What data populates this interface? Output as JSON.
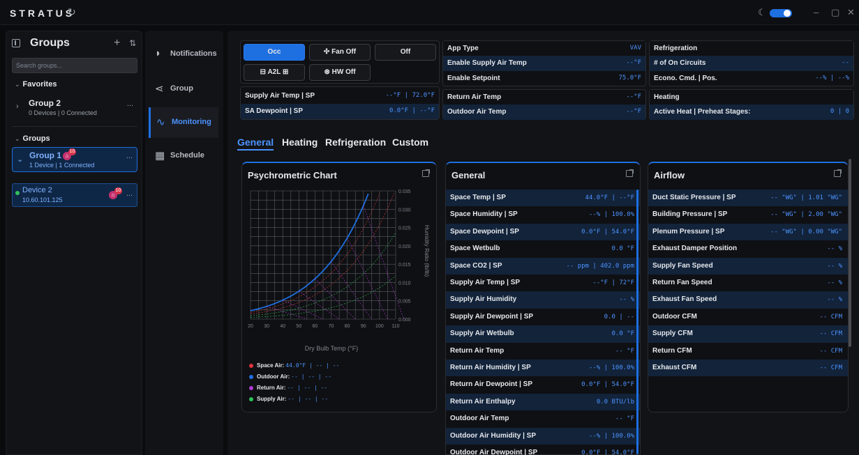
{
  "app": {
    "title": "STRATUS",
    "refresh_icon": "refresh-icon",
    "theme_icon": "moon-icon",
    "win_min": "–",
    "win_max": "▢",
    "win_close": "✕"
  },
  "groups": {
    "title": "Groups",
    "add_icon": "+",
    "sort_icon": "⇅",
    "search_placeholder": "Search groups...",
    "favorites_label": "Favorites",
    "groups_label": "Groups",
    "favorites": [
      {
        "name": "Group 2",
        "sub": "0 Devices | 0 Connected",
        "menu": "..."
      }
    ],
    "list": [
      {
        "name": "Group 1",
        "sub": "1 Device | 1 Connected",
        "badge": "10",
        "menu": "..."
      }
    ],
    "device": {
      "name": "Device 2",
      "ip": "10.60.101.125",
      "badge": "10",
      "menu": "..."
    }
  },
  "nav": [
    {
      "label": "Notifications",
      "icon": "notifications-icon"
    },
    {
      "label": "Group",
      "icon": "share-icon"
    },
    {
      "label": "Monitoring",
      "icon": "chart-icon"
    },
    {
      "label": "Schedule",
      "icon": "calendar-icon"
    }
  ],
  "controls": {
    "occ": "Occ",
    "fan": "Fan Off",
    "off": "Off",
    "a2l": "A2L",
    "hw": "HW Off"
  },
  "supply": [
    {
      "k": "Supply Air Temp | SP",
      "v": "--°F | 72.0°F"
    },
    {
      "k": "SA Dewpoint | SP",
      "v": "0.0°F | --°F"
    }
  ],
  "app_info": [
    {
      "k": "App Type",
      "v": "VAV"
    },
    {
      "k": "Enable Supply Air Temp",
      "v": "--°F"
    },
    {
      "k": "Enable Setpoint",
      "v": "75.0°F"
    }
  ],
  "return_info": [
    {
      "k": "Return Air Temp",
      "v": "--°F"
    },
    {
      "k": "Outdoor Air Temp",
      "v": "--°F"
    }
  ],
  "refrigeration": [
    {
      "k": "Refrigeration",
      "v": ""
    },
    {
      "k": "# of On Circuits",
      "v": "--"
    },
    {
      "k": "Econo. Cmd. | Pos.",
      "v": "--% | --%"
    }
  ],
  "heating": [
    {
      "k": "Heating",
      "v": ""
    },
    {
      "k": "Active Heat | Preheat Stages:",
      "v": "0 | 0"
    }
  ],
  "tabs": [
    "General",
    "Heating",
    "Refrigeration",
    "Custom"
  ],
  "psychro": {
    "title": "Psychrometric Chart",
    "xlabel": "Dry Bulb Temp (°F)",
    "ylabel": "Humidity Ratio (lb/lb)",
    "x_ticks": [
      "20",
      "30",
      "40",
      "50",
      "60",
      "70",
      "80",
      "90",
      "100",
      "110"
    ],
    "y_ticks": [
      "0.035",
      "0.030",
      "0.025",
      "0.020",
      "0.015",
      "0.010",
      "0.005",
      "0.000"
    ],
    "legend": [
      {
        "label": "Space Air:",
        "value": "44.0°F | -- | --",
        "color": "#e0323c"
      },
      {
        "label": "Outdoor Air:",
        "value": "-- | -- | --",
        "color": "#1e6fe0"
      },
      {
        "label": "Return Air:",
        "value": "-- | -- | --",
        "color": "#b23ad6"
      },
      {
        "label": "Supply Air:",
        "value": "-- | -- | --",
        "color": "#2fc25b"
      }
    ]
  },
  "general": {
    "title": "General",
    "rows": [
      {
        "k": "Space Temp | SP",
        "v": "44.0°F | --°F"
      },
      {
        "k": "Space Humidity | SP",
        "v": "--% | 100.0%"
      },
      {
        "k": "Space Dewpoint | SP",
        "v": "0.0°F | 54.0°F"
      },
      {
        "k": "Space Wetbulb",
        "v": "0.0 °F"
      },
      {
        "k": "Space CO2 | SP",
        "v": "-- ppm | 402.0 ppm"
      },
      {
        "k": "Supply Air Temp | SP",
        "v": "--°F | 72°F"
      },
      {
        "k": "Supply Air Humidity",
        "v": "-- %"
      },
      {
        "k": "Supply Air Dewpoint | SP",
        "v": "0.0 | --"
      },
      {
        "k": "Supply Air Wetbulb",
        "v": "0.0 °F"
      },
      {
        "k": "Return Air Temp",
        "v": "-- °F"
      },
      {
        "k": "Return Air Humidity | SP",
        "v": "--% | 100.0%"
      },
      {
        "k": "Return Air Dewpoint | SP",
        "v": "0.0°F | 54.0°F"
      },
      {
        "k": "Return Air Enthalpy",
        "v": "0.0 BTU/lb"
      },
      {
        "k": "Outdoor Air Temp",
        "v": "-- °F"
      },
      {
        "k": "Outdoor Air Humidity | SP",
        "v": "--% | 100.0%"
      },
      {
        "k": "Outdoor Air Dewpoint | SP",
        "v": "0.0°F | 54.0°F"
      }
    ]
  },
  "airflow": {
    "title": "Airflow",
    "rows": [
      {
        "k": "Duct Static Pressure | SP",
        "v": "-- \"WG\" | 1.01 \"WG\""
      },
      {
        "k": "Building Pressure | SP",
        "v": "-- \"WG\" | 2.00 \"WG\""
      },
      {
        "k": "Plenum Pressure | SP",
        "v": "-- \"WG\" | 0.00 \"WG\""
      },
      {
        "k": "Exhaust Damper Position",
        "v": "-- %"
      },
      {
        "k": "Supply Fan Speed",
        "v": "-- %"
      },
      {
        "k": "Return Fan Speed",
        "v": "-- %"
      },
      {
        "k": "Exhaust Fan Speed",
        "v": "-- %"
      },
      {
        "k": "Outdoor CFM",
        "v": "-- CFM"
      },
      {
        "k": "Supply CFM",
        "v": "-- CFM"
      },
      {
        "k": "Return CFM",
        "v": "-- CFM"
      },
      {
        "k": "Exhaust CFM",
        "v": "-- CFM"
      }
    ]
  }
}
